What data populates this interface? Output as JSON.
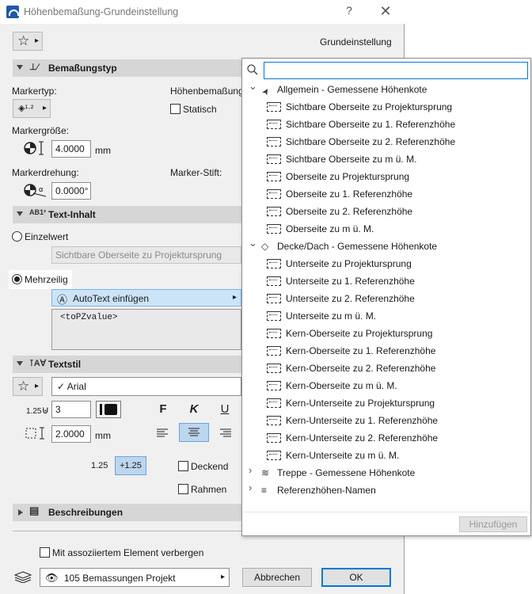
{
  "window": {
    "title": "Höhenbemaßung-Grundeinstellung",
    "help": "?",
    "close": "✕"
  },
  "favorites": {
    "star": "☆",
    "arrow": "▸"
  },
  "header": {
    "preset_label": "Grundeinstellung"
  },
  "sections": {
    "bemassungstyp": "Bemaßungstyp",
    "textinhalt": "Text-Inhalt",
    "textstil": "Textstil",
    "beschreibungen": "Beschreibungen"
  },
  "markertyp": {
    "label": "Markertyp:",
    "icon": "◈¹·²"
  },
  "hoehenbemassung": {
    "label": "Höhenbemaßung",
    "statisch_label": "Statisch"
  },
  "markergroesse": {
    "label": "Markergröße:",
    "value": "4.0000",
    "unit": "mm"
  },
  "markerdrehung": {
    "label": "Markerdrehung:",
    "value": "0.0000°"
  },
  "markerstift": {
    "label": "Marker-Stift:"
  },
  "textinhalt": {
    "einzelwert_label": "Einzelwert",
    "einzelwert_value": "Sichtbare Oberseite zu Projektursprung",
    "mehrzeilig_label": "Mehrzeilig",
    "autotext_label": "AutoText einfügen",
    "autotext_arrow": "▸",
    "autotext_value": "<toPZvalue>"
  },
  "textstil": {
    "font": "Arial",
    "font_check": "✓",
    "size_value": "3",
    "spacing_value": "2.0000",
    "spacing_unit": "mm",
    "bold": "F",
    "italic": "K",
    "underline": "U",
    "sample_plain": "1.25",
    "sample_plus": "+1.25",
    "deckend_label": "Deckend",
    "rahmen_label": "Rahmen",
    "size_prefix": "1.25"
  },
  "footer": {
    "hide_label": "Mit assoziiertem Element verbergen",
    "layer_value": "105 Bemassungen Projekt",
    "cancel_label": "Abbrechen",
    "ok_label": "OK"
  },
  "popup": {
    "search_placeholder": "",
    "groups": [
      {
        "label": "Allgemein - Gemessene Höhenkote",
        "expanded": true,
        "items": [
          "Sichtbare Oberseite zu Projektursprung",
          "Sichtbare Oberseite zu 1. Referenzhöhe",
          "Sichtbare Oberseite zu 2. Referenzhöhe",
          "Sichtbare Oberseite zu m ü. M.",
          "Oberseite zu Projektursprung",
          "Oberseite zu 1. Referenzhöhe",
          "Oberseite zu 2. Referenzhöhe",
          "Oberseite zu m ü. M."
        ]
      },
      {
        "label": "Decke/Dach - Gemessene Höhenkote",
        "expanded": true,
        "items": [
          "Unterseite zu Projektursprung",
          "Unterseite zu 1. Referenzhöhe",
          "Unterseite zu 2. Referenzhöhe",
          "Unterseite zu m ü. M.",
          "Kern-Oberseite zu Projektursprung",
          "Kern-Oberseite zu 1. Referenzhöhe",
          "Kern-Oberseite zu 2. Referenzhöhe",
          "Kern-Oberseite zu m ü. M.",
          "Kern-Unterseite zu Projektursprung",
          "Kern-Unterseite zu 1. Referenzhöhe",
          "Kern-Unterseite zu 2. Referenzhöhe",
          "Kern-Unterseite zu m ü. M."
        ]
      },
      {
        "label": "Treppe - Gemessene Höhenkote",
        "expanded": false,
        "items": []
      },
      {
        "label": "Referenzhöhen-Namen",
        "expanded": false,
        "items": []
      }
    ],
    "add_label": "Hinzufügen"
  },
  "colors": {
    "accent": "#0078d7",
    "selected_bg": "#cce4f7",
    "section_bg": "#d6d6d6"
  }
}
